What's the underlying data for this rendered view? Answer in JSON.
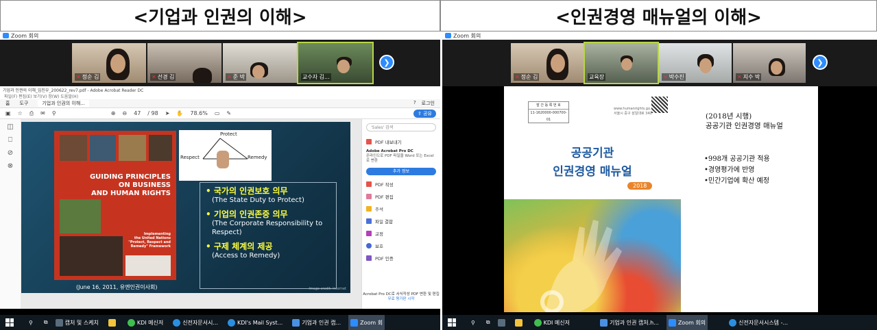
{
  "headers": {
    "left": "<기업과 인권의 이해>",
    "right": "<인권경영 매뉴얼의 이해>"
  },
  "zoom_bar": {
    "left": "Zoom 회의",
    "right": "Zoom 회의"
  },
  "left_participants": [
    "정순 김",
    "선경 김",
    "준 박",
    "교수자 김..."
  ],
  "right_participants": [
    "정순 김",
    "교육장",
    "박수진",
    "지수 박"
  ],
  "acrobat": {
    "window_title": "기업과 인권의 이해_임진우_200622_rev7.pdf - Adobe Acrobat Reader DC",
    "menu": "파일(F)  편집(E)  보기(V)  창(W)  도움말(H)",
    "tabs": [
      "홈",
      "도구",
      "기업과 인권의 이해..."
    ],
    "help": "?",
    "login": "로그인",
    "page_current": "47",
    "page_total": "/ 98",
    "zoom": "78.6%",
    "share": "공유",
    "left_tools": [
      "◫",
      "⎕",
      "⊘",
      "⊗"
    ]
  },
  "slide": {
    "book_title": [
      "GUIDING PRINCIPLES",
      "ON BUSINESS",
      "AND HUMAN RIGHTS"
    ],
    "book_sub": [
      "Implementing",
      "the United Nations",
      "\"Protect, Respect and",
      "Remedy\" Framework"
    ],
    "book_caption": "(June 16, 2011, 유엔인권이사회)",
    "triangle": {
      "top": "Protect",
      "left": "Respect",
      "right": "Remedy"
    },
    "items": [
      {
        "ko": "국가의 인권보호 의무",
        "en": "(The State Duty to Protect)"
      },
      {
        "ko": "기업의 인권존중 의무",
        "en": "(The Corporate Responsibility to Respect)"
      },
      {
        "ko": "구제 체계의 제공",
        "en": "(Access to Remedy)"
      }
    ],
    "credit": "Image credit: Internet"
  },
  "right_pane": {
    "search": "'Sales' 검색",
    "export": "PDF 내보내기",
    "promo_title": "Adobe Acrobat Pro DC",
    "promo_text": "온라인으로 PDF 파일을 Word 또는 Excel로 변환",
    "more_btn": "추가 정보",
    "tools": [
      "PDF 작성",
      "PDF 편집",
      "주석",
      "파일 결합",
      "교정",
      "보호",
      "PDF 인증"
    ],
    "bottom_text": "Acrobat Pro DC로 서식작성 PDF 변환 및 편집",
    "trial": "무료 평가판 시작"
  },
  "document": {
    "box_label": "발 간 등 록 번 호",
    "box_number": "11-1620000-000700-01",
    "url": [
      "www.humanrights.go.kr",
      "서울시 중구 삼일대로 340"
    ],
    "title": [
      "공공기관",
      "인권경영 매뉴얼"
    ],
    "year": "2018",
    "heading": [
      "(2018년 시행)",
      "공공기관 인권경영 매뉴얼"
    ],
    "bullets": [
      "•998개 공공기관 적용",
      "•경영평가에 반영",
      "•민간기업에 확산 예정"
    ]
  },
  "taskbar_left": [
    "캡처 및 스케치",
    "",
    "KDI 메신저",
    "신전자문서시...",
    "KDI's Mail Syst...",
    "기업과 인권 캡...",
    "Zoom 회"
  ],
  "taskbar_right": [
    "",
    "KDI 메신저",
    "기업과 인권 캡처.h...",
    "Zoom 회의",
    "신전자문서시스템 -..."
  ],
  "colors": {
    "zoom_blue": "#2d8cff",
    "acrobat_blue": "#2d7be0",
    "slide_bg": "#1f5472",
    "highlight": "#ffff3c",
    "doc_title": "#1e5aa0",
    "taskbar": "#101820"
  }
}
